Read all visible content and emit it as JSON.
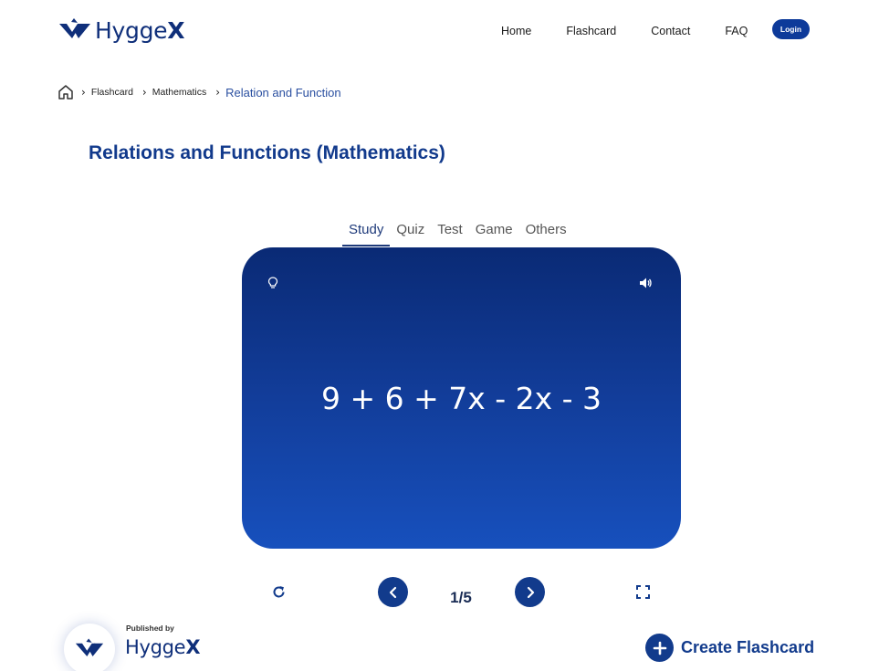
{
  "brand": {
    "name_part1": "Hygge",
    "name_part2": "X"
  },
  "nav": {
    "items": [
      {
        "label": "Home"
      },
      {
        "label": "Flashcard"
      },
      {
        "label": "Contact"
      },
      {
        "label": "FAQ"
      }
    ],
    "login_label": "Login"
  },
  "breadcrumb": {
    "items": [
      {
        "label": "Flashcard"
      },
      {
        "label": "Mathematics"
      },
      {
        "label": "Relation and Function"
      }
    ]
  },
  "page": {
    "title": "Relations and Functions (Mathematics)"
  },
  "tabs": [
    {
      "label": "Study",
      "active": true
    },
    {
      "label": "Quiz"
    },
    {
      "label": "Test"
    },
    {
      "label": "Game"
    },
    {
      "label": "Others"
    }
  ],
  "card": {
    "text": "9 + 6 + 7x - 2x - 3"
  },
  "controls": {
    "counter": "1/5"
  },
  "footer": {
    "published_by": "Published by",
    "create_label": "Create Flashcard"
  },
  "colors": {
    "primary": "#123b8c",
    "card_top": "#0a2a75",
    "card_bottom": "#1750bd"
  }
}
